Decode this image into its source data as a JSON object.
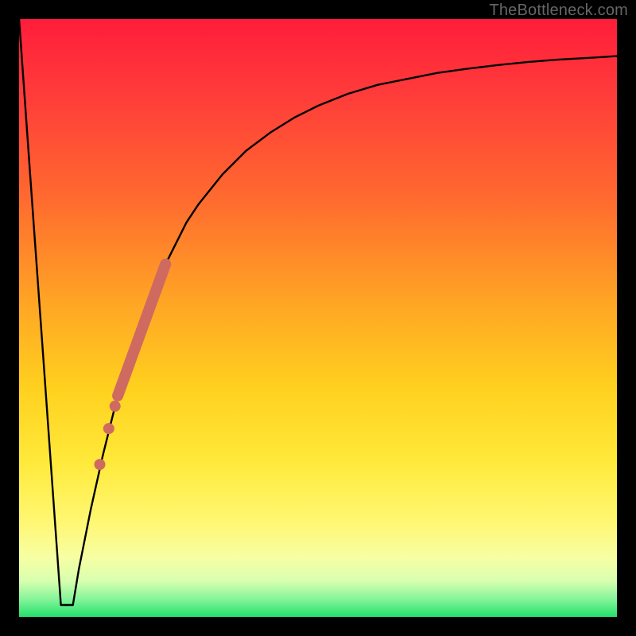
{
  "watermark": "TheBottleneck.com",
  "colors": {
    "frame": "#000000",
    "curve": "#000000",
    "highlight": "#cf6a61"
  },
  "chart_data": {
    "type": "line",
    "title": "",
    "xlabel": "",
    "ylabel": "",
    "xlim": [
      0,
      100
    ],
    "ylim": [
      0,
      100
    ],
    "grid": false,
    "curve_note": "x is horizontal position 0-100 (left→right); y is bottleneck percentage 0-100 (higher = worse, drawn nearer the top). Values estimated from pixel positions.",
    "x": [
      0,
      2,
      4,
      6,
      7,
      8,
      9,
      10,
      12,
      14,
      16,
      18,
      20,
      22,
      24,
      26,
      28,
      30,
      34,
      38,
      42,
      46,
      50,
      55,
      60,
      65,
      70,
      75,
      80,
      85,
      90,
      95,
      100
    ],
    "y": [
      100,
      72,
      44,
      16,
      2,
      2,
      2,
      8,
      18,
      27,
      35,
      42,
      48,
      53,
      58,
      62,
      66,
      69,
      74,
      78,
      81,
      83.5,
      85.5,
      87.5,
      89,
      90,
      91,
      91.7,
      92.3,
      92.8,
      93.2,
      93.5,
      93.8
    ],
    "highlight_segments": [
      {
        "x": [
          16.5,
          24.5
        ],
        "y": [
          37,
          59
        ],
        "style": "thick"
      },
      {
        "x": [
          14.5,
          15.5
        ],
        "y": [
          30,
          33
        ],
        "style": "dot"
      },
      {
        "x": [
          13.0,
          14.0
        ],
        "y": [
          24,
          27
        ],
        "style": "dot"
      },
      {
        "x": [
          15.8,
          16.3
        ],
        "y": [
          34.5,
          36
        ],
        "style": "dot"
      }
    ]
  }
}
